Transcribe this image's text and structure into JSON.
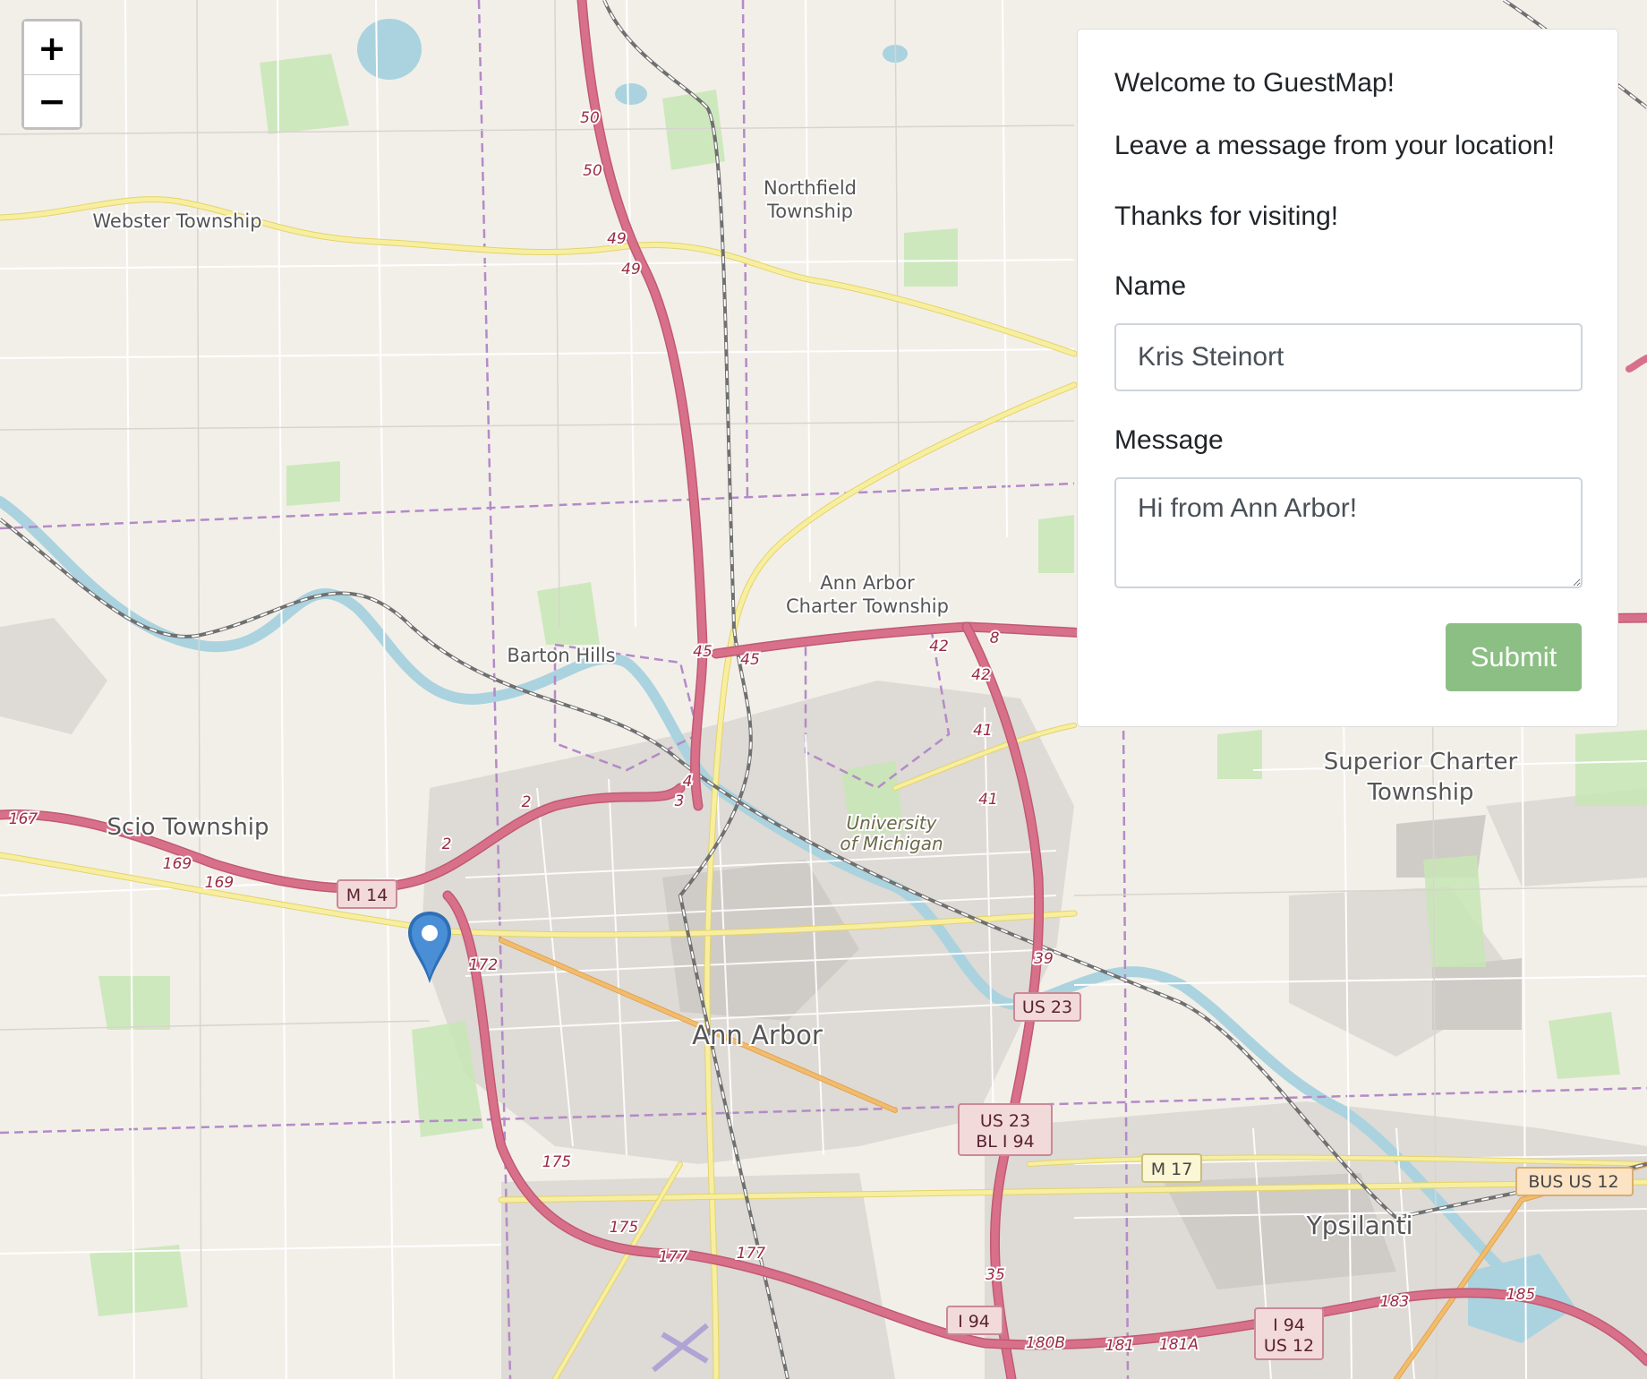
{
  "map": {
    "zoom_in": "+",
    "zoom_out": "−",
    "marker_icon": "map-pin-icon",
    "places": {
      "webster": "Webster Township",
      "northfield_1": "Northfield",
      "northfield_2": "Township",
      "annarbor_twp_1": "Ann Arbor",
      "annarbor_twp_2": "Charter Township",
      "barton": "Barton Hills",
      "scio": "Scio Township",
      "university_1": "University",
      "university_2": "of Michigan",
      "superior_1": "Superior Charter",
      "superior_2": "Township",
      "annarbor": "Ann Arbor",
      "ypsilanti": "Ypsilanti"
    },
    "shields": {
      "m14": "M 14",
      "us23": "US 23",
      "us23_bl_1": "US 23",
      "us23_bl_2": "BL I 94",
      "m17": "M 17",
      "bus_us12": "BUS US 12",
      "i94": "I 94",
      "i94_us12_1": "I 94",
      "i94_us12_2": "US 12"
    },
    "exits": [
      "50",
      "50",
      "49",
      "49",
      "45",
      "45",
      "42",
      "42",
      "8",
      "41",
      "41",
      "39",
      "4",
      "3",
      "2",
      "2",
      "167",
      "169",
      "169",
      "172",
      "175",
      "175",
      "177",
      "177",
      "35",
      "180B",
      "181",
      "181A",
      "183",
      "185"
    ]
  },
  "panel": {
    "welcome": "Welcome to GuestMap!",
    "leave": "Leave a message from your location!",
    "thanks": "Thanks for visiting!",
    "name_label": "Name",
    "name_value": "Kris Steinort",
    "message_label": "Message",
    "message_value": "Hi from Ann Arbor!",
    "submit": "Submit"
  },
  "colors": {
    "land": "#f2efe9",
    "urban": "#d9d6d2",
    "park": "#c8e6b5",
    "water": "#aad3df",
    "motorway": "#d9708a",
    "primary": "#f5e88c",
    "secondary": "#f1bd6c",
    "boundary": "#b48ac8",
    "submit": "#8cbf84",
    "marker": "#3a7dc9"
  }
}
